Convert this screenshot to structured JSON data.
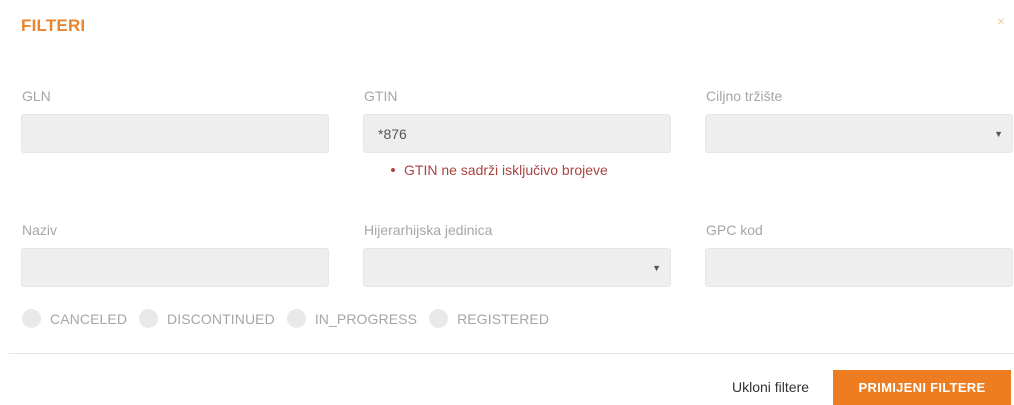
{
  "modal": {
    "title": "FILTERI",
    "close_label": "×"
  },
  "fields": {
    "gln": {
      "label": "GLN",
      "value": ""
    },
    "gtin": {
      "label": "GTIN",
      "value": "*876",
      "error": "GTIN ne sadrži isključivo brojeve"
    },
    "target_market": {
      "label": "Ciljno tržište",
      "value": ""
    },
    "name": {
      "label": "Naziv",
      "value": ""
    },
    "hierarchy_unit": {
      "label": "Hijerarhijska jedinica",
      "value": ""
    },
    "gpc_code": {
      "label": "GPC kod",
      "value": ""
    }
  },
  "statuses": [
    {
      "label": "CANCELED"
    },
    {
      "label": "DISCONTINUED"
    },
    {
      "label": "IN_PROGRESS"
    },
    {
      "label": "REGISTERED"
    }
  ],
  "footer": {
    "clear_label": "Ukloni filtere",
    "apply_label": "PRIMIJENI FILTERE"
  },
  "colors": {
    "accent": "#ee7d22",
    "title": "#e8852f",
    "error": "#a94442",
    "input_bg": "#eeeeee"
  }
}
